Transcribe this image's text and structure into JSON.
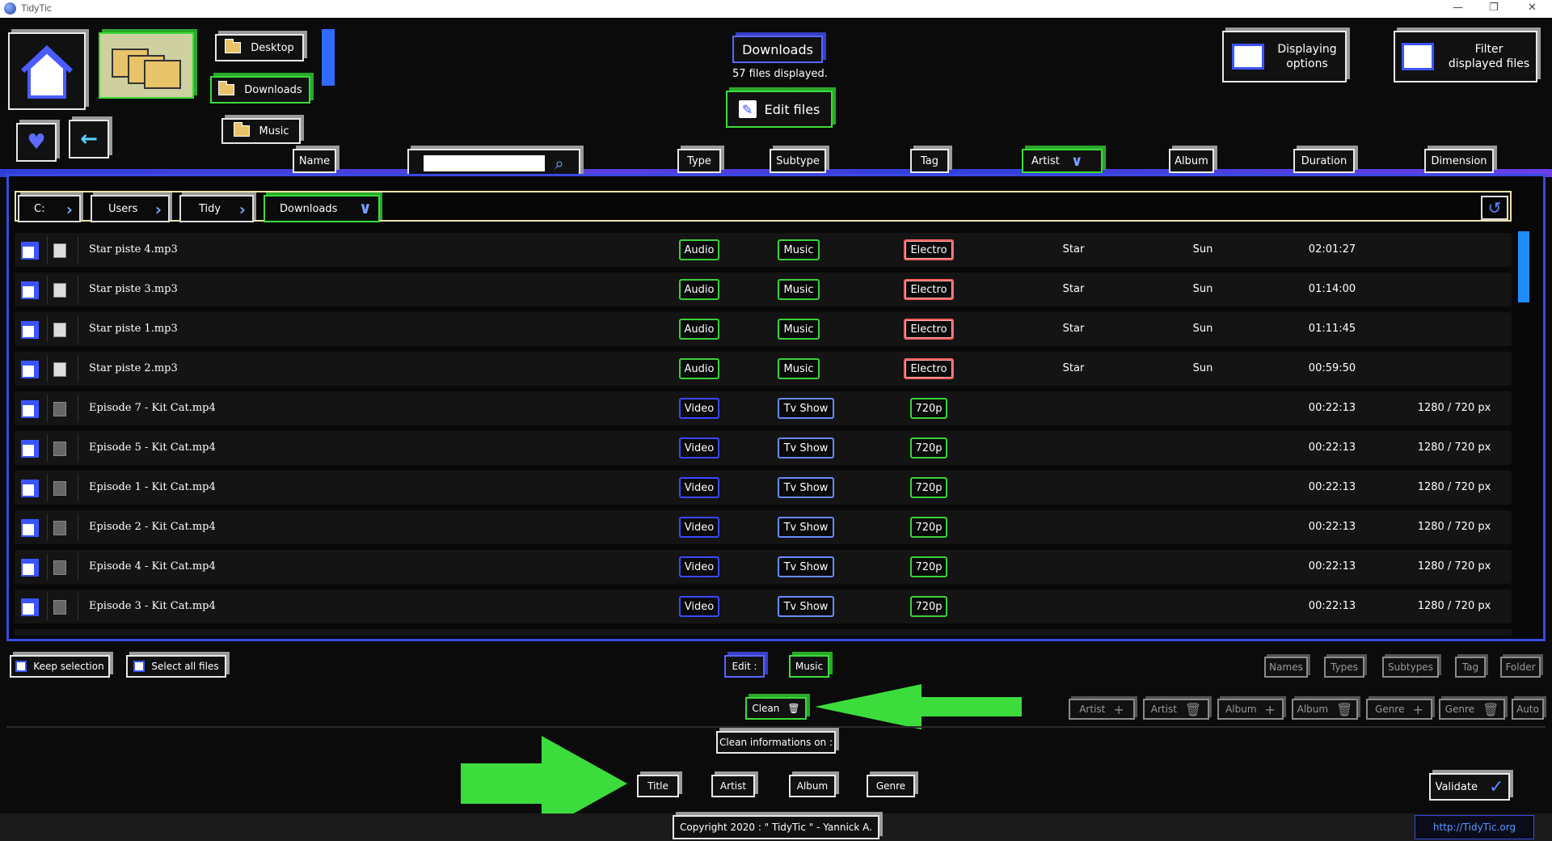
{
  "window": {
    "title": "TidyTic",
    "min": "—",
    "max": "❐",
    "close": "✕"
  },
  "nav": {
    "desktop": "Desktop",
    "downloads": "Downloads",
    "music": "Music"
  },
  "current": {
    "folder": "Downloads",
    "files_count": "57 files displayed.",
    "edit_files": "Edit files"
  },
  "top_right": {
    "displaying_options_1": "Displaying",
    "displaying_options_2": "options",
    "filter_1": "Filter",
    "filter_2": "displayed files"
  },
  "columns": {
    "name": "Name",
    "search_placeholder": "",
    "type": "Type",
    "subtype": "Subtype",
    "tag": "Tag",
    "artist": "Artist",
    "album": "Album",
    "duration": "Duration",
    "dimension": "Dimension"
  },
  "breadcrumb": [
    "C:",
    "Users",
    "Tidy",
    "Downloads"
  ],
  "files": [
    {
      "name": "Star piste 4.mp3",
      "type": "Audio",
      "subtype": "Music",
      "tag": "Electro",
      "artist": "Star",
      "album": "Sun",
      "duration": "02:01:27",
      "dimension": ""
    },
    {
      "name": "Star piste 3.mp3",
      "type": "Audio",
      "subtype": "Music",
      "tag": "Electro",
      "artist": "Star",
      "album": "Sun",
      "duration": "01:14:00",
      "dimension": ""
    },
    {
      "name": "Star piste 1.mp3",
      "type": "Audio",
      "subtype": "Music",
      "tag": "Electro",
      "artist": "Star",
      "album": "Sun",
      "duration": "01:11:45",
      "dimension": ""
    },
    {
      "name": "Star piste 2.mp3",
      "type": "Audio",
      "subtype": "Music",
      "tag": "Electro",
      "artist": "Star",
      "album": "Sun",
      "duration": "00:59:50",
      "dimension": ""
    },
    {
      "name": "Episode 7 - Kit Cat.mp4",
      "type": "Video",
      "subtype": "Tv Show",
      "tag": "720p",
      "artist": "",
      "album": "",
      "duration": "00:22:13",
      "dimension": "1280 / 720 px"
    },
    {
      "name": "Episode 5 - Kit Cat.mp4",
      "type": "Video",
      "subtype": "Tv Show",
      "tag": "720p",
      "artist": "",
      "album": "",
      "duration": "00:22:13",
      "dimension": "1280 / 720 px"
    },
    {
      "name": "Episode 1 - Kit Cat.mp4",
      "type": "Video",
      "subtype": "Tv Show",
      "tag": "720p",
      "artist": "",
      "album": "",
      "duration": "00:22:13",
      "dimension": "1280 / 720 px"
    },
    {
      "name": "Episode 2 - Kit Cat.mp4",
      "type": "Video",
      "subtype": "Tv Show",
      "tag": "720p",
      "artist": "",
      "album": "",
      "duration": "00:22:13",
      "dimension": "1280 / 720 px"
    },
    {
      "name": "Episode 4 - Kit Cat.mp4",
      "type": "Video",
      "subtype": "Tv Show",
      "tag": "720p",
      "artist": "",
      "album": "",
      "duration": "00:22:13",
      "dimension": "1280 / 720 px"
    },
    {
      "name": "Episode 3 - Kit Cat.mp4",
      "type": "Video",
      "subtype": "Tv Show",
      "tag": "720p",
      "artist": "",
      "album": "",
      "duration": "00:22:13",
      "dimension": "1280 / 720 px"
    }
  ],
  "bottom": {
    "keep_selection": "Keep selection",
    "select_all": "Select all files",
    "edit_label": "Edit :",
    "music": "Music",
    "right_tabs": [
      "Names",
      "Types",
      "Subtypes",
      "Tag",
      "Folder"
    ],
    "clean": "Clean",
    "meta_buttons": [
      "Artist",
      "Artist",
      "Album",
      "Album",
      "Genre",
      "Genre",
      "Auto"
    ],
    "clean_info": "Clean informations on :",
    "clean_fields": [
      "Title",
      "Artist",
      "Album",
      "Genre"
    ],
    "validate": "Validate",
    "copyright": "Copyright 2020 : \" TidyTic \" - Yannick A.",
    "website": "http://TidyTic.org"
  },
  "colors": {
    "accent_blue": "#3a4ae0",
    "accent_green": "#3ddc3d",
    "tag_red": "#ff6060"
  }
}
